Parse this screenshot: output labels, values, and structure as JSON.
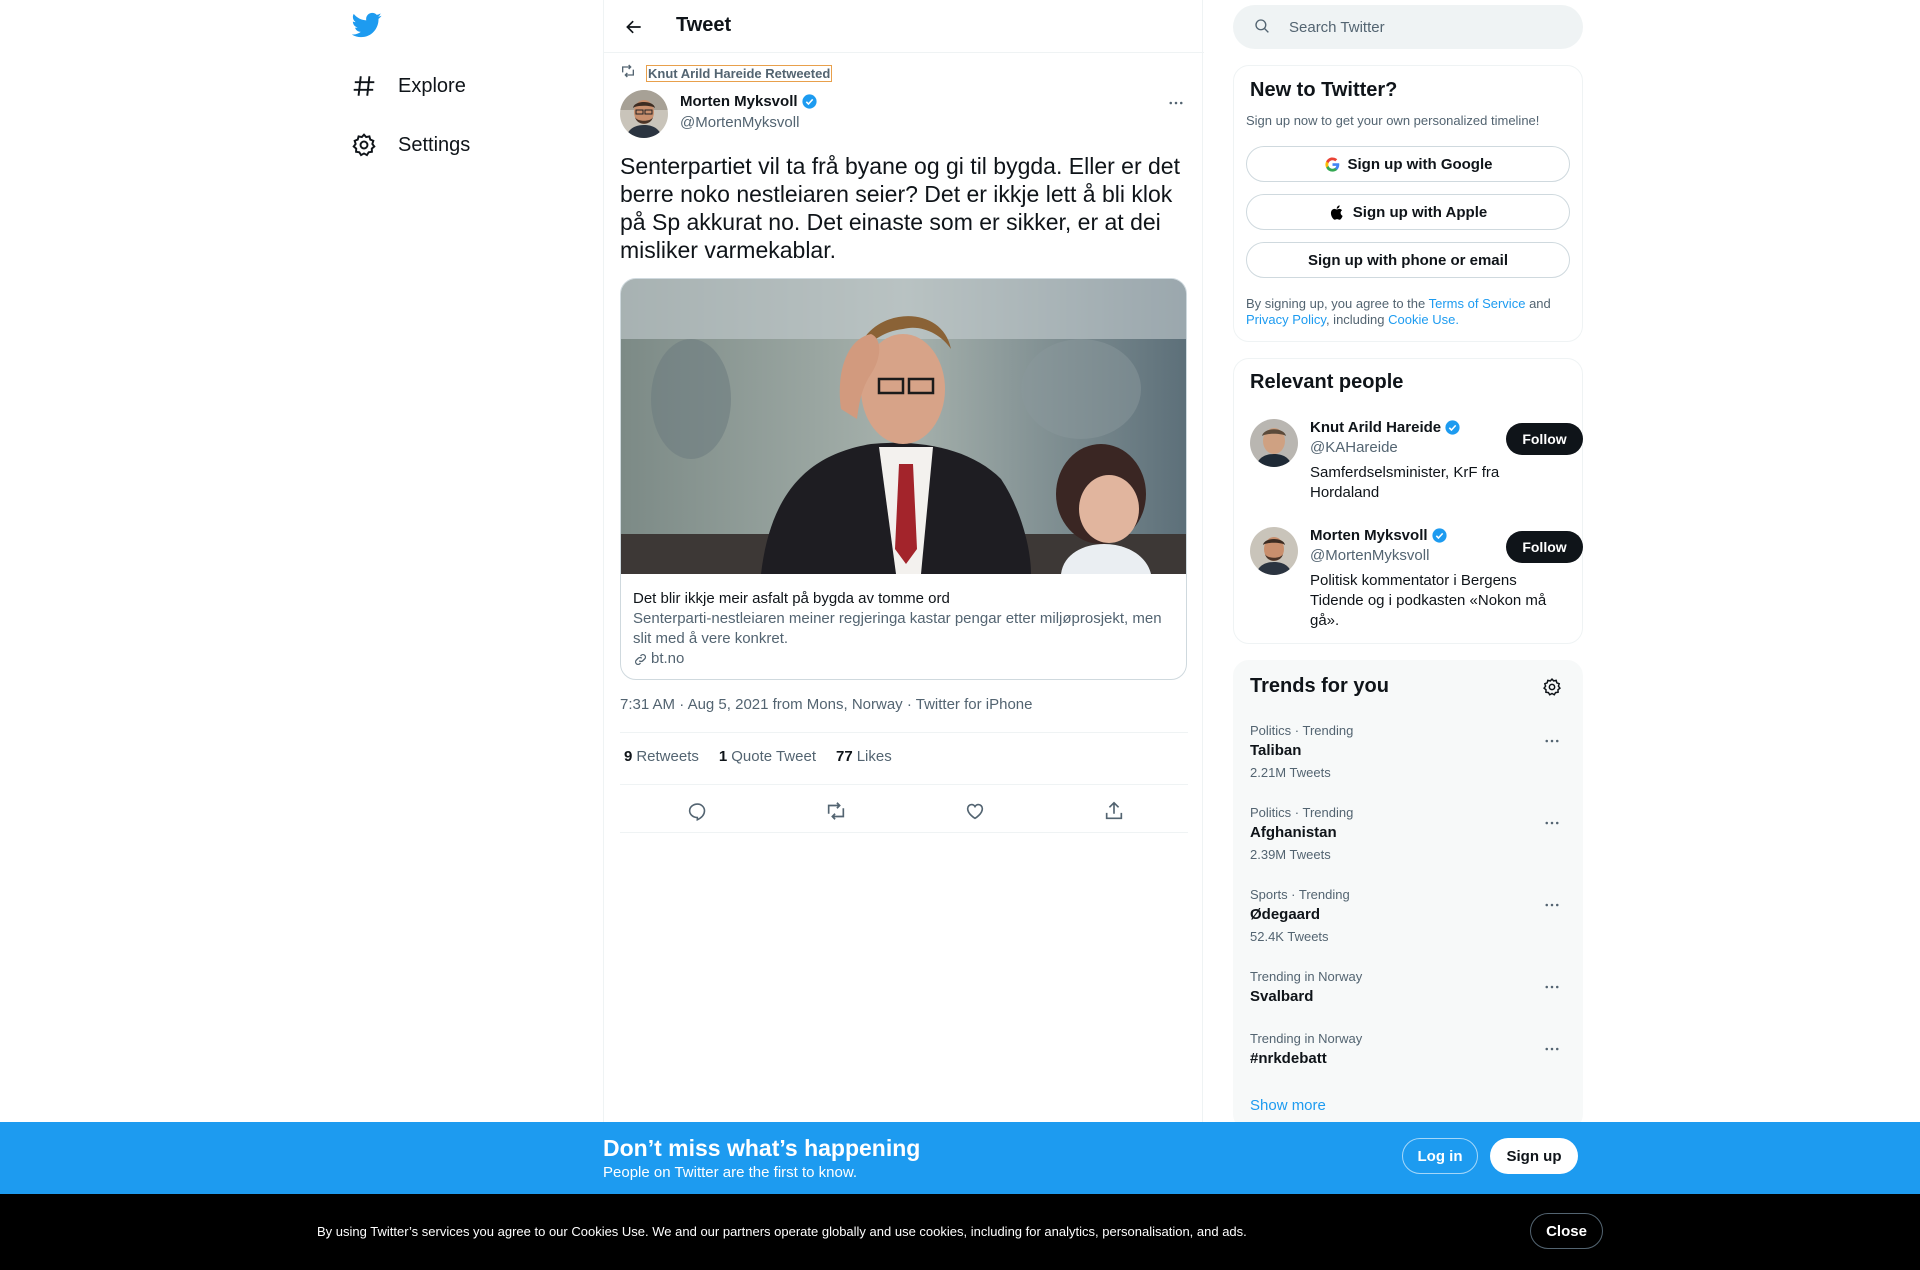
{
  "nav": {
    "items": [
      {
        "label": "Explore",
        "icon": "hashtag-icon"
      },
      {
        "label": "Settings",
        "icon": "gear-icon"
      }
    ]
  },
  "header": {
    "title": "Tweet"
  },
  "tweet": {
    "retweeted_by": "Knut Arild Hareide Retweeted",
    "author_name": "Morten Myksvoll",
    "author_handle": "@MortenMyksvoll",
    "text": "Senterpartiet vil ta frå byane og gi til bygda. Eller er det berre noko nestleiaren seier? Det er ikkje lett å bli klok på Sp akkurat no. Det einaste som er sikker, er at dei misliker varmekablar.",
    "card": {
      "title": "Det blir ikkje meir asfalt på bygda av tomme ord",
      "description": "Senterparti-nestleiaren meiner regjeringa kastar pengar etter miljøprosjekt, men slit med å vere konkret.",
      "domain": "bt.no"
    },
    "time": "7:31 AM",
    "date": "Aug 5, 2021",
    "location": "from Mons, Norway",
    "source": "Twitter for iPhone",
    "stats": {
      "retweets_count": "9",
      "retweets_label": "Retweets",
      "quotes_count": "1",
      "quotes_label": "Quote Tweet",
      "likes_count": "77",
      "likes_label": "Likes"
    }
  },
  "search": {
    "placeholder": "Search Twitter"
  },
  "signup_panel": {
    "title": "New to Twitter?",
    "subtitle": "Sign up now to get your own personalized timeline!",
    "google": "Sign up with Google",
    "apple": "Sign up with Apple",
    "phone": "Sign up with phone or email",
    "legal_prefix": "By signing up, you agree to the",
    "terms": "Terms of Service",
    "and": "and",
    "privacy": "Privacy Policy",
    "including": ", including",
    "cookie": "Cookie Use."
  },
  "relevant": {
    "title": "Relevant people",
    "people": [
      {
        "name": "Knut Arild Hareide",
        "handle": "@KAHareide",
        "bio": "Samferdselsminister, KrF fra Hordaland",
        "follow": "Follow"
      },
      {
        "name": "Morten Myksvoll",
        "handle": "@MortenMyksvoll",
        "bio": "Politisk kommentator i Bergens Tidende og i podkasten «Nokon må gå».",
        "follow": "Follow"
      }
    ]
  },
  "trends": {
    "title": "Trends for you",
    "items": [
      {
        "category": "Politics · Trending",
        "name": "Taliban",
        "count": "2.21M Tweets"
      },
      {
        "category": "Politics · Trending",
        "name": "Afghanistan",
        "count": "2.39M Tweets"
      },
      {
        "category": "Sports · Trending",
        "name": "Ødegaard",
        "count": "52.4K Tweets"
      },
      {
        "category": "Trending in Norway",
        "name": "Svalbard",
        "count": ""
      },
      {
        "category": "Trending in Norway",
        "name": "#nrkdebatt",
        "count": ""
      }
    ],
    "show_more": "Show more"
  },
  "bottom_bar": {
    "heading": "Don’t miss what’s happening",
    "sub": "People on Twitter are the first to know.",
    "login": "Log in",
    "signup": "Sign up"
  },
  "cookie_bar": {
    "text": "By using Twitter’s services you agree to our Cookies Use. We and our partners operate globally and use cookies, including for analytics, personalisation, and ads.",
    "close": "Close"
  },
  "colors": {
    "brand": "#1d9bf0",
    "text": "#0f1419",
    "secondary": "#536471",
    "border": "#eff3f4"
  }
}
